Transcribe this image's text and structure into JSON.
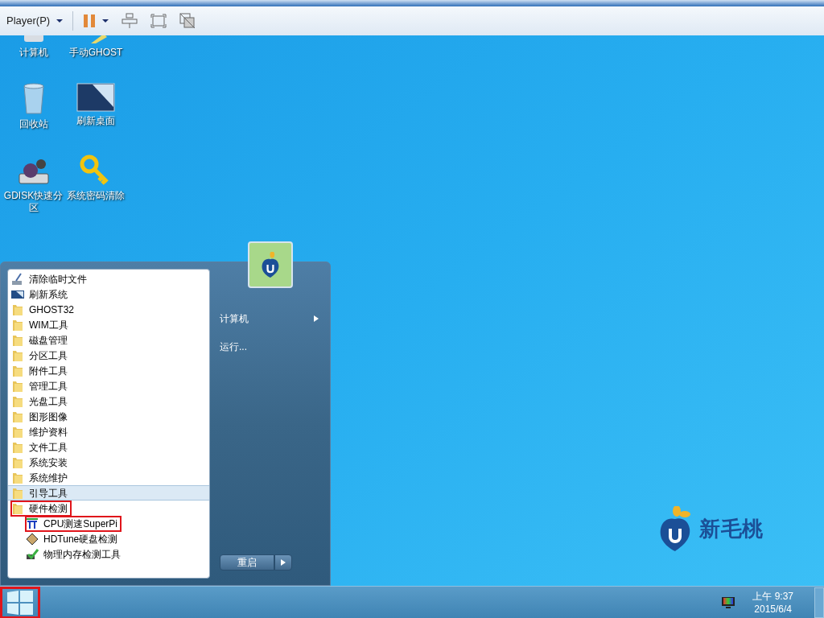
{
  "toolbar": {
    "player_menu": "Player(P)",
    "paused": true
  },
  "desktop_icons": [
    {
      "label": "计算机",
      "kind": "computer"
    },
    {
      "label": "手动GHOST",
      "kind": "ghost"
    },
    {
      "label": "回收站",
      "kind": "recycle"
    },
    {
      "label": "刷新桌面",
      "kind": "screen"
    },
    {
      "label": "GDISK快速分区",
      "kind": "disk"
    },
    {
      "label": "系统密码清除",
      "kind": "key"
    }
  ],
  "start_menu": {
    "programs": [
      {
        "label": "清除临时文件",
        "kind": "cleaner",
        "selected": false,
        "highlighted": false
      },
      {
        "label": "刷新系统",
        "kind": "screen",
        "selected": false,
        "highlighted": false
      },
      {
        "label": "GHOST32",
        "kind": "folder",
        "selected": false,
        "highlighted": false
      },
      {
        "label": "WIM工具",
        "kind": "folder",
        "selected": false,
        "highlighted": false
      },
      {
        "label": "磁盘管理",
        "kind": "folder",
        "selected": false,
        "highlighted": false
      },
      {
        "label": "分区工具",
        "kind": "folder",
        "selected": false,
        "highlighted": false
      },
      {
        "label": "附件工具",
        "kind": "folder",
        "selected": false,
        "highlighted": false
      },
      {
        "label": "管理工具",
        "kind": "folder",
        "selected": false,
        "highlighted": false
      },
      {
        "label": "光盘工具",
        "kind": "folder",
        "selected": false,
        "highlighted": false
      },
      {
        "label": "图形图像",
        "kind": "folder",
        "selected": false,
        "highlighted": false
      },
      {
        "label": "维护资料",
        "kind": "folder",
        "selected": false,
        "highlighted": false
      },
      {
        "label": "文件工具",
        "kind": "folder",
        "selected": false,
        "highlighted": false
      },
      {
        "label": "系统安装",
        "kind": "folder",
        "selected": false,
        "highlighted": false
      },
      {
        "label": "系统维护",
        "kind": "folder",
        "selected": false,
        "highlighted": false
      },
      {
        "label": "引导工具",
        "kind": "folder",
        "selected": true,
        "highlighted": false
      },
      {
        "label": "硬件检测",
        "kind": "folder",
        "selected": false,
        "highlighted": true,
        "children": [
          {
            "label": "CPU测速SuperPi",
            "kind": "pi",
            "selected": false,
            "highlighted": true
          },
          {
            "label": "HDTune硬盘检测",
            "kind": "hdd",
            "selected": false,
            "highlighted": false
          },
          {
            "label": "物理内存检测工具",
            "kind": "memory",
            "selected": false,
            "highlighted": false
          }
        ]
      }
    ],
    "right_items": [
      {
        "label": "计算机",
        "has_submenu": true
      },
      {
        "label": "运行...",
        "has_submenu": false
      }
    ],
    "shutdown_button": "重启"
  },
  "brand": {
    "name": "新毛桃"
  },
  "taskbar": {
    "start_highlighted": true,
    "clock_time": "上午 9:37",
    "clock_date": "2015/6/4"
  }
}
